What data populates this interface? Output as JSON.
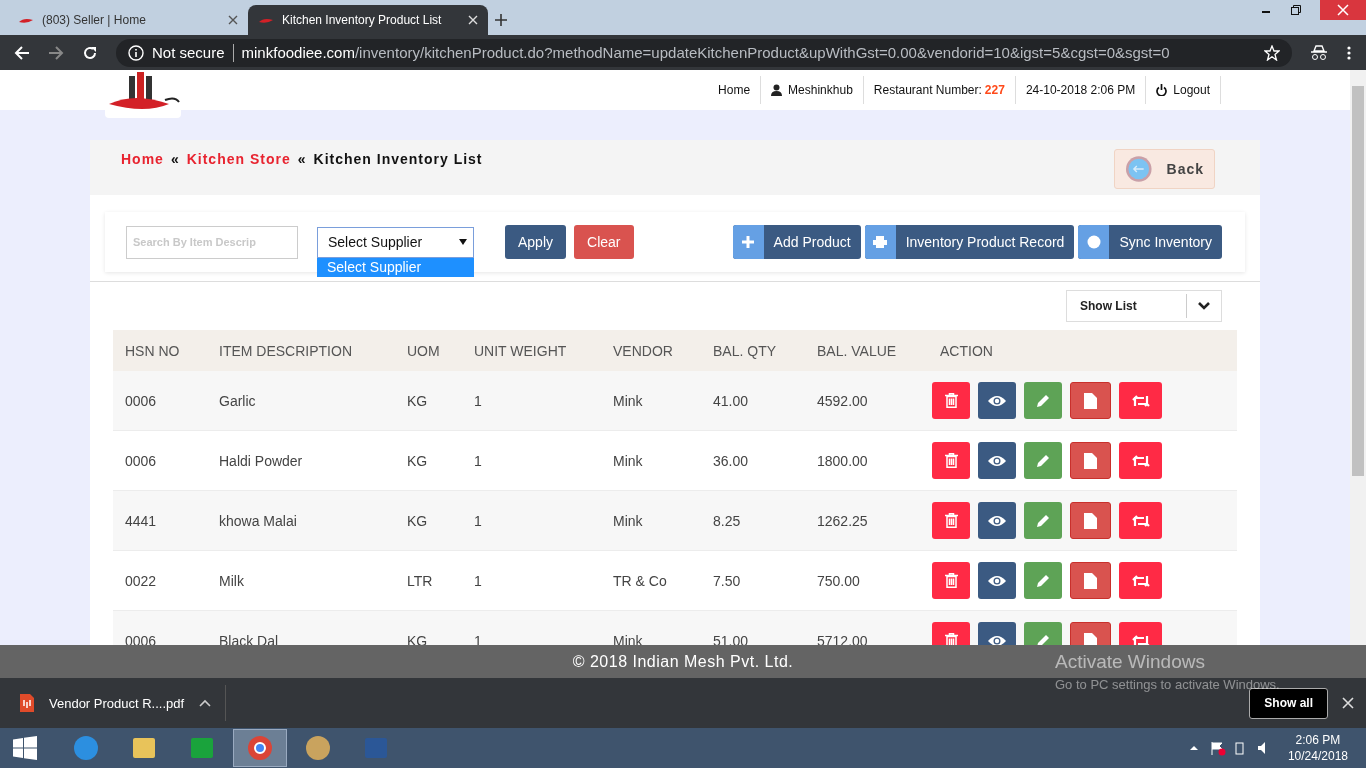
{
  "browser": {
    "tabs": [
      {
        "title": "(803) Seller | Home",
        "selected": false
      },
      {
        "title": "Kitchen Inventory Product List",
        "selected": true
      }
    ],
    "security": "Not secure",
    "url_host": "minkfoodiee.com",
    "url_path": "/inventory/kitchenProduct.do?methodName=updateKitchenProduct&upWithGst=0.00&vendorid=10&igst=5&cgst=0&sgst=0"
  },
  "header": {
    "home": "Home",
    "user": "Meshinkhub",
    "restaurant_label": "Restaurant Number:",
    "restaurant_number": "227",
    "datetime": "24-10-2018 2:06 PM",
    "logout": "Logout"
  },
  "breadcrumb": [
    {
      "label": "Home",
      "kind": "link"
    },
    {
      "label": "«",
      "kind": "sep"
    },
    {
      "label": "Kitchen Store",
      "kind": "link"
    },
    {
      "label": "«",
      "kind": "sep"
    },
    {
      "label": "Kitchen Inventory List",
      "kind": "current"
    }
  ],
  "back_button": "Back",
  "filters": {
    "search": {
      "placeholder": "Search By Item Descrip"
    },
    "supplier": {
      "value": "Select Supplier",
      "options": [
        {
          "label": "Select Supplier",
          "selected": true
        }
      ]
    },
    "apply": "Apply",
    "clear": "Clear"
  },
  "actions": [
    {
      "label": "Add Product",
      "kind": "plus"
    },
    {
      "label": "Inventory Product Record",
      "kind": "print"
    },
    {
      "label": "Sync Inventory",
      "kind": "circle"
    }
  ],
  "show_list": "Show List",
  "table": {
    "columns": [
      "HSN NO",
      "ITEM DESCRIPTION",
      "UOM",
      "UNIT WEIGHT",
      "VENDOR",
      "BAL. QTY",
      "BAL. VALUE",
      "ACTION"
    ],
    "rows": [
      [
        "0006",
        "Garlic",
        "KG",
        "1",
        "Mink",
        "41.00",
        "4592.00"
      ],
      [
        "0006",
        "Haldi Powder",
        "KG",
        "1",
        "Mink",
        "36.00",
        "1800.00"
      ],
      [
        "4441",
        "khowa Malai",
        "KG",
        "1",
        "Mink",
        "8.25",
        "1262.25"
      ],
      [
        "0022",
        "Milk",
        "LTR",
        "1",
        "TR & Co",
        "7.50",
        "750.00"
      ],
      [
        "0006",
        "Black Dal",
        "KG",
        "1",
        "Mink",
        "51.00",
        "5712.00"
      ]
    ]
  },
  "footer": "© 2018 Indian Mesh Pvt. Ltd.",
  "activation": {
    "title": "Activate Windows",
    "subtitle": "Go to PC settings to activate Windows."
  },
  "download": {
    "file": "Vendor Product R....pdf",
    "show_all": "Show all"
  },
  "taskbar": {
    "apps": [
      {
        "kind": "ie",
        "selected": false
      },
      {
        "kind": "explorer",
        "selected": false
      },
      {
        "kind": "store",
        "selected": false
      },
      {
        "kind": "chrome",
        "selected": true
      },
      {
        "kind": "paint",
        "selected": false
      },
      {
        "kind": "word",
        "selected": false
      }
    ],
    "time": "2:06 PM",
    "date": "10/24/2018"
  }
}
